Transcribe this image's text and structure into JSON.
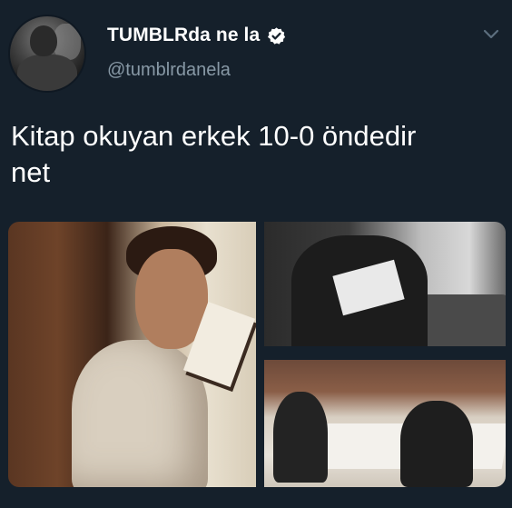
{
  "user": {
    "display_name": "TUMBLRda ne la",
    "handle": "@tumblrdanela",
    "verified": true
  },
  "tweet": {
    "text": "Kitap okuyan erkek 10-0 öndedir\nnet"
  },
  "media": {
    "photos": [
      "photo-1",
      "photo-2",
      "photo-3"
    ]
  },
  "icons": {
    "verified": "verified-badge-icon",
    "menu": "chevron-down-icon"
  },
  "colors": {
    "background": "#15202b",
    "text": "#ffffff",
    "secondary_text": "#8899a6"
  }
}
